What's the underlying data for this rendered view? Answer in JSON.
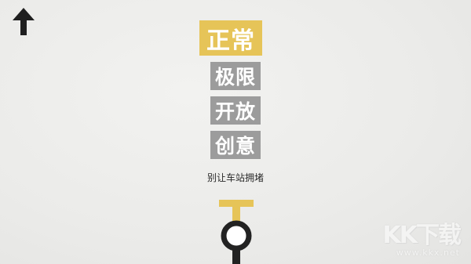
{
  "nav": {
    "back_icon": "up-arrow-icon"
  },
  "menu": {
    "modes": [
      {
        "label": "正常",
        "selected": true,
        "color": "#e6c458"
      },
      {
        "label": "极限",
        "selected": false,
        "color": "#9c9c9c"
      },
      {
        "label": "开放",
        "selected": false,
        "color": "#9c9c9c"
      },
      {
        "label": "创意",
        "selected": false,
        "color": "#9c9c9c"
      }
    ],
    "description": "别让车站拥堵"
  },
  "preview": {
    "line_color": "#e6c458",
    "station_color": "#222222",
    "track_color": "#222222"
  },
  "watermark": {
    "logo": "KK下载",
    "url": "www.kkx.net"
  }
}
